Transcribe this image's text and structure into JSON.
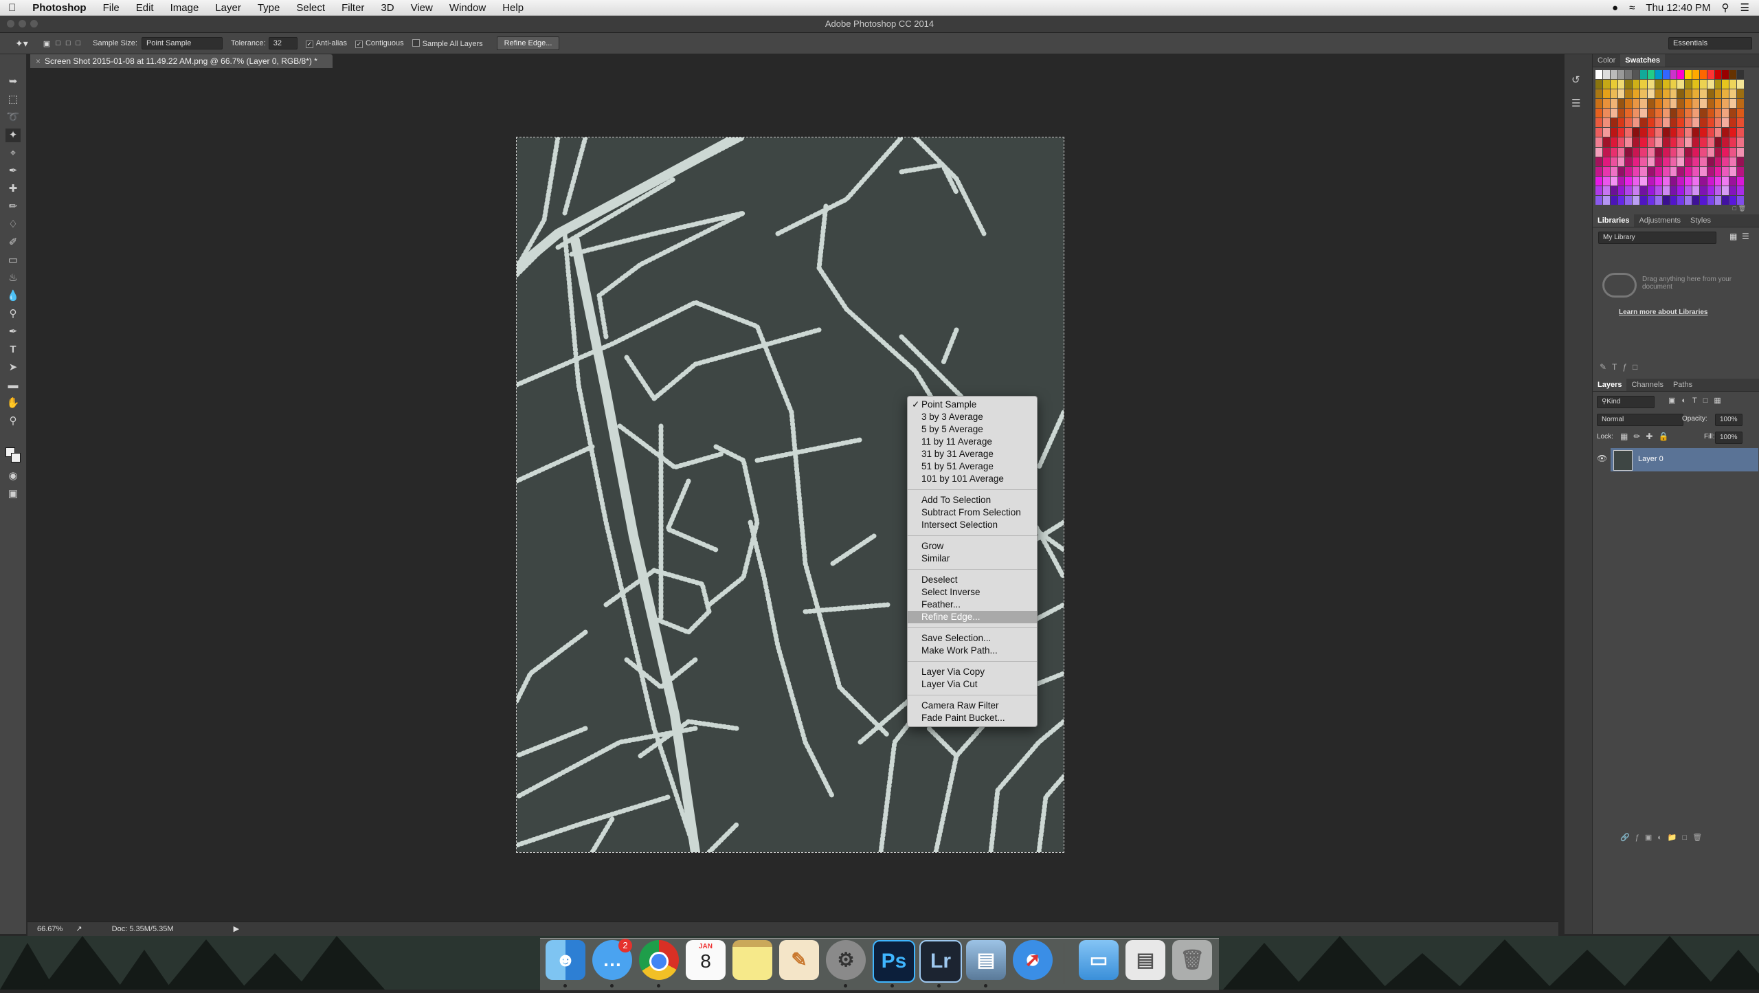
{
  "menubar": {
    "app": "Photoshop",
    "items": [
      "File",
      "Edit",
      "Image",
      "Layer",
      "Type",
      "Select",
      "Filter",
      "3D",
      "View",
      "Window",
      "Help"
    ],
    "clock": "Thu 12:40 PM"
  },
  "window": {
    "title": "Adobe Photoshop CC 2014"
  },
  "options": {
    "sample_size_label": "Sample Size:",
    "sample_size_value": "Point Sample",
    "tolerance_label": "Tolerance:",
    "tolerance_value": "32",
    "antialias_label": "Anti-alias",
    "contiguous_label": "Contiguous",
    "sample_all_label": "Sample All Layers",
    "refine_button": "Refine Edge...",
    "workspace": "Essentials"
  },
  "document": {
    "tab_label": "Screen Shot 2015-01-08 at 11.49.22 AM.png @ 66.7% (Layer 0, RGB/8*) *"
  },
  "status": {
    "zoom": "66.67%",
    "doc_info": "Doc: 5.35M/5.35M"
  },
  "context_menu": {
    "groups": [
      [
        "Point Sample",
        "3 by 3 Average",
        "5 by 5 Average",
        "11 by 11 Average",
        "31 by 31 Average",
        "51 by 51 Average",
        "101 by 101 Average"
      ],
      [
        "Add To Selection",
        "Subtract From Selection",
        "Intersect Selection"
      ],
      [
        "Grow",
        "Similar"
      ],
      [
        "Deselect",
        "Select Inverse",
        "Feather...",
        "Refine Edge..."
      ],
      [
        "Save Selection...",
        "Make Work Path..."
      ],
      [
        "Layer Via Copy",
        "Layer Via Cut"
      ],
      [
        "Camera Raw Filter",
        "Fade Paint Bucket..."
      ]
    ],
    "checked": "Point Sample",
    "highlighted": "Refine Edge..."
  },
  "panels": {
    "color_tabs": [
      "Color",
      "Swatches"
    ],
    "library_tabs": [
      "Libraries",
      "Adjustments",
      "Styles"
    ],
    "library_select": "My Library",
    "library_hint": "Drag anything here from your document",
    "library_link": "Learn more about Libraries",
    "layers_tabs": [
      "Layers",
      "Channels",
      "Paths"
    ],
    "kind_label": "Kind",
    "blend_mode": "Normal",
    "opacity_label": "Opacity:",
    "opacity_value": "100%",
    "lock_label": "Lock:",
    "fill_label": "Fill:",
    "fill_value": "100%",
    "layer_name": "Layer 0"
  },
  "dock": {
    "messages_badge": "2",
    "calendar_month": "JAN",
    "calendar_day": "8",
    "photoshop": "Ps",
    "lightroom": "Lr"
  },
  "colors": {
    "canvas_bg": "#3e4644",
    "road": "#cdd8d4",
    "layer_selected": "#5a7396",
    "menu_highlight": "#a9a9a9"
  }
}
